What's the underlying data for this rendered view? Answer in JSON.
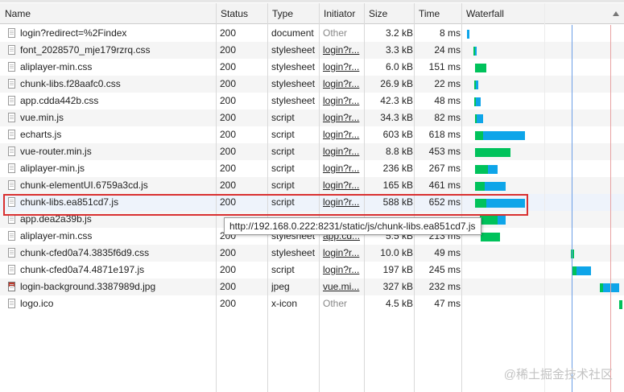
{
  "columns": {
    "name": "Name",
    "status": "Status",
    "type": "Type",
    "initiator": "Initiator",
    "size": "Size",
    "time": "Time",
    "waterfall": "Waterfall"
  },
  "rows": [
    {
      "name": "login?redirect=%2Findex",
      "status": "200",
      "type": "document",
      "initiator": "Other",
      "size": "3.2 kB",
      "time": "8 ms"
    },
    {
      "name": "font_2028570_mje179rzrq.css",
      "status": "200",
      "type": "stylesheet",
      "initiator": "login?r...",
      "size": "3.3 kB",
      "time": "24 ms"
    },
    {
      "name": "aliplayer-min.css",
      "status": "200",
      "type": "stylesheet",
      "initiator": "login?r...",
      "size": "6.0 kB",
      "time": "151 ms"
    },
    {
      "name": "chunk-libs.f28aafc0.css",
      "status": "200",
      "type": "stylesheet",
      "initiator": "login?r...",
      "size": "26.9 kB",
      "time": "22 ms"
    },
    {
      "name": "app.cdda442b.css",
      "status": "200",
      "type": "stylesheet",
      "initiator": "login?r...",
      "size": "42.3 kB",
      "time": "48 ms"
    },
    {
      "name": "vue.min.js",
      "status": "200",
      "type": "script",
      "initiator": "login?r...",
      "size": "34.3 kB",
      "time": "82 ms"
    },
    {
      "name": "echarts.js",
      "status": "200",
      "type": "script",
      "initiator": "login?r...",
      "size": "603 kB",
      "time": "618 ms"
    },
    {
      "name": "vue-router.min.js",
      "status": "200",
      "type": "script",
      "initiator": "login?r...",
      "size": "8.8 kB",
      "time": "453 ms"
    },
    {
      "name": "aliplayer-min.js",
      "status": "200",
      "type": "script",
      "initiator": "login?r...",
      "size": "236 kB",
      "time": "267 ms"
    },
    {
      "name": "chunk-elementUI.6759a3cd.js",
      "status": "200",
      "type": "script",
      "initiator": "login?r...",
      "size": "165 kB",
      "time": "461 ms"
    },
    {
      "name": "chunk-libs.ea851cd7.js",
      "status": "200",
      "type": "script",
      "initiator": "login?r...",
      "size": "588 kB",
      "time": "652 ms"
    },
    {
      "name": "app.dea2a39b.js",
      "status": "",
      "type": "",
      "initiator": "",
      "size": "",
      "time": ""
    },
    {
      "name": "aliplayer-min.css",
      "status": "200",
      "type": "stylesheet",
      "initiator": "app.cd...",
      "size": "5.5 kB",
      "time": "213 ms"
    },
    {
      "name": "chunk-cfed0a74.3835f6d9.css",
      "status": "200",
      "type": "stylesheet",
      "initiator": "login?r...",
      "size": "10.0 kB",
      "time": "49 ms"
    },
    {
      "name": "chunk-cfed0a74.4871e197.js",
      "status": "200",
      "type": "script",
      "initiator": "login?r...",
      "size": "197 kB",
      "time": "245 ms"
    },
    {
      "name": "login-background.3387989d.jpg",
      "status": "200",
      "type": "jpeg",
      "initiator": "vue.mi...",
      "size": "327 kB",
      "time": "232 ms"
    },
    {
      "name": "logo.ico",
      "status": "200",
      "type": "x-icon",
      "initiator": "Other",
      "size": "4.5 kB",
      "time": "47 ms"
    }
  ],
  "tooltip": "http://192.168.0.222:8231/static/js/chunk-libs.ea851cd7.js",
  "watermark": "@稀土掘金技术社区",
  "colors": {
    "waiting": "#00c25b",
    "download": "#0ea5e9"
  }
}
